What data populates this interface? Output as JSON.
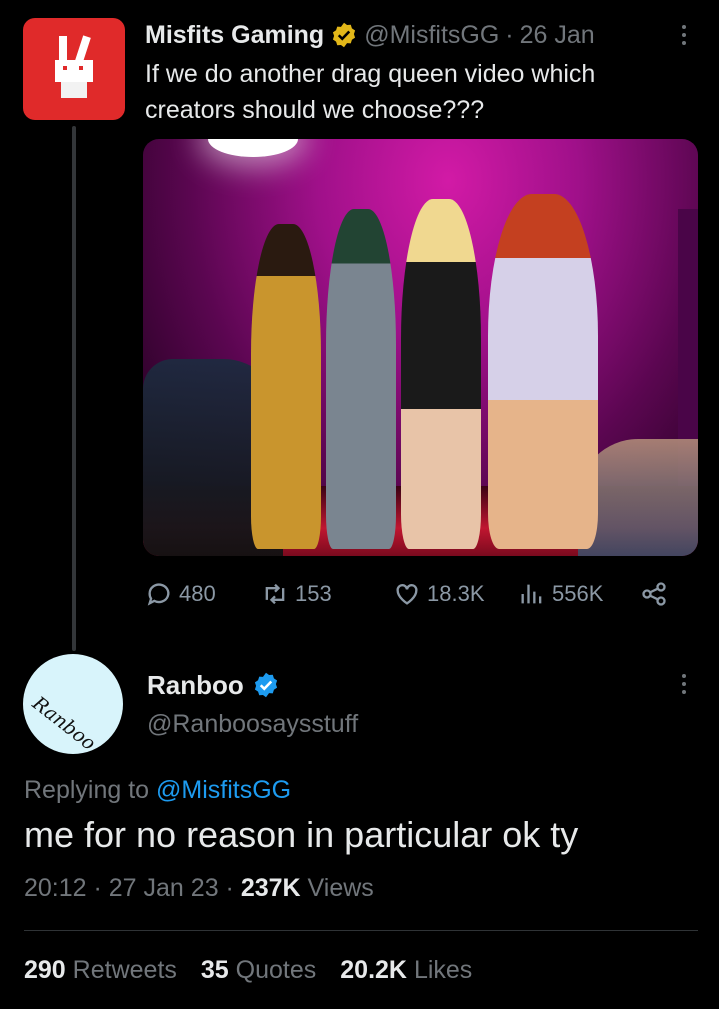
{
  "tweet": {
    "author_name": "Misfits Gaming",
    "author_handle": "@MisfitsGG",
    "separator": "·",
    "date": "26 Jan",
    "text": "If we do another drag queen video which creators should we choose???",
    "verified_color": "#e2b719",
    "actions": {
      "reply_count": "480",
      "retweet_count": "153",
      "like_count": "18.3K",
      "view_count": "556K"
    }
  },
  "reply": {
    "author_name": "Ranboo",
    "author_handle": "@Ranboosaysstuff",
    "avatar_signature": "Ranboo",
    "verified_color": "#1d9bf0",
    "replying_prefix": "Replying to",
    "replying_to": "@MisfitsGG",
    "text": "me for no reason in particular ok ty",
    "timestamp": "20:12 · 27 Jan 23 ·",
    "views_count": "237K",
    "views_label": "Views",
    "stats": {
      "retweets_count": "290",
      "retweets_label": "Retweets",
      "quotes_count": "35",
      "quotes_label": "Quotes",
      "likes_count": "20.2K",
      "likes_label": "Likes"
    }
  },
  "colors": {
    "background": "#000000",
    "text_primary": "#e7e9ea",
    "text_secondary": "#71767b",
    "link": "#1d9bf0"
  }
}
